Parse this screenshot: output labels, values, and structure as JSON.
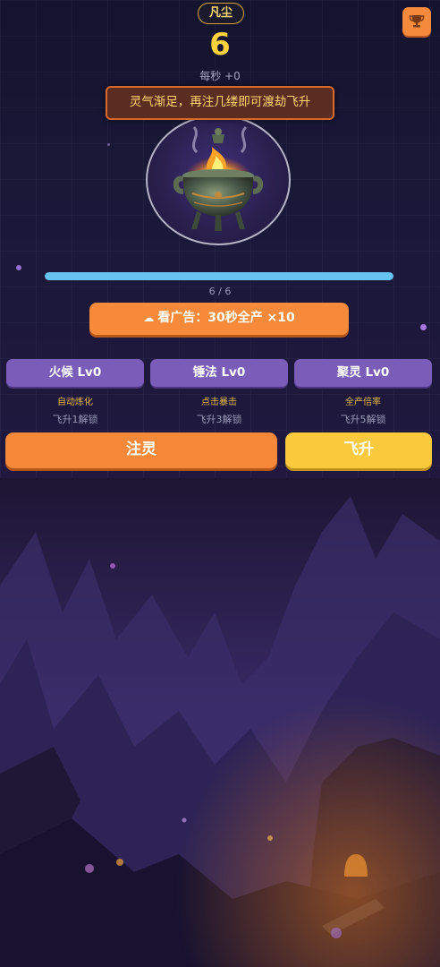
{
  "header": {
    "realm_label": "凡尘",
    "score": "6",
    "rate_text": "每秒 +0",
    "trophy_icon": "trophy-icon"
  },
  "hint": {
    "text": "灵气渐足，再注几缕即可渡劫飞升"
  },
  "cauldron": {
    "icon": "incense-burner-icon"
  },
  "progress": {
    "text": "6 / 6",
    "fraction": 1.0
  },
  "ad_button": {
    "icon": "cloud-icon",
    "icon_glyph": "☁",
    "label": "看广告：30秒全产 ×10"
  },
  "upgrades": [
    {
      "label": "火候 Lv0",
      "desc": "自动炼化",
      "lock": "飞升1解锁"
    },
    {
      "label": "锤法 Lv0",
      "desc": "点击暴击",
      "lock": "飞升3解锁"
    },
    {
      "label": "聚灵 Lv0",
      "desc": "全产倍率",
      "lock": "飞升5解锁"
    }
  ],
  "actions": {
    "infuse_label": "注灵",
    "ascend_label": "飞升"
  },
  "colors": {
    "accent_orange": "#f6883a",
    "accent_yellow": "#fbc93c",
    "upgrade_purple": "#7a5db8",
    "progress_blue": "#67c4f0",
    "score_gold": "#ffd23c"
  }
}
